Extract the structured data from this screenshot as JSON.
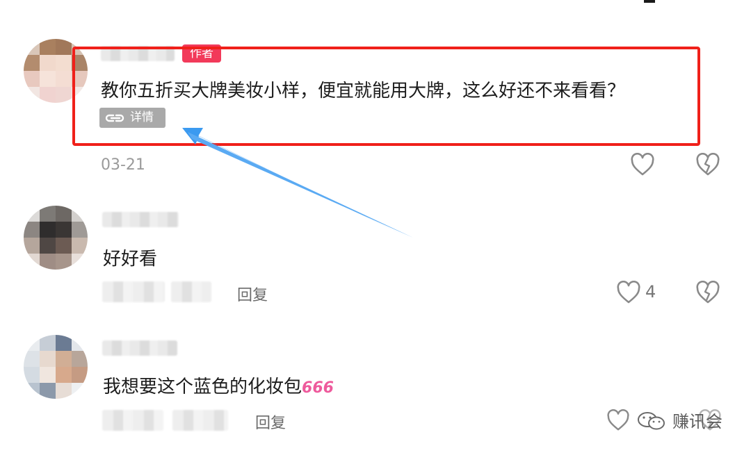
{
  "comments": [
    {
      "badge": "作者",
      "text": "教你五折买大牌美妆小样，便宜就能用大牌，这么好还不来看看？",
      "detail_label": "详情",
      "date": "03-21"
    },
    {
      "text": "好好看",
      "reply_label": "回复",
      "like_count": "4"
    },
    {
      "text": "我想要这个蓝色的化妆包",
      "emoji": "666",
      "reply_label": "回复"
    }
  ],
  "watermark": "赚讯会",
  "colors": {
    "highlight_border": "#f0201a",
    "author_badge": "#f23a5a",
    "arrow": "#3b9af0"
  },
  "icons": [
    "heart-outline-icon",
    "broken-heart-icon",
    "link-icon",
    "wechat-icon"
  ]
}
